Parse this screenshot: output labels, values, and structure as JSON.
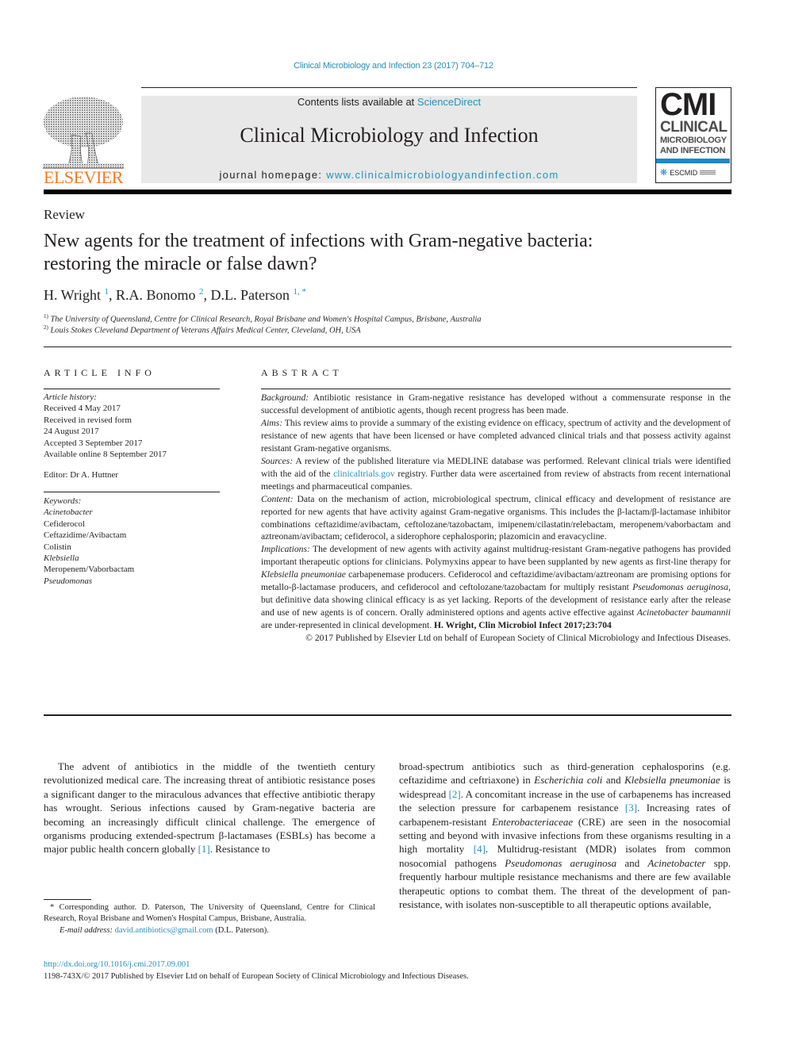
{
  "header": {
    "citation": "Clinical Microbiology and Infection 23 (2017) 704–712",
    "contents_prefix": "Contents lists available at ",
    "contents_link": "ScienceDirect",
    "journal_name": "Clinical Microbiology and Infection",
    "homepage_prefix": "journal homepage: ",
    "homepage_link": "www.clinicalmicrobiologyandinfection.com",
    "publisher_logo_text": "ELSEVIER",
    "cmi_logo": {
      "big": "CMI",
      "line1": "CLINICAL",
      "line2": "MICROBIOLOGY",
      "line3": "AND INFECTION",
      "society": "ESCMID"
    }
  },
  "article": {
    "type": "Review",
    "title": "New agents for the treatment of infections with Gram-negative bacteria: restoring the miracle or false dawn?",
    "authors": [
      {
        "name": "H. Wright",
        "sup": "1"
      },
      {
        "name": "R.A. Bonomo",
        "sup": "2"
      },
      {
        "name": "D.L. Paterson",
        "sup": "1, *"
      }
    ],
    "affiliations": [
      {
        "mark": "1)",
        "text": "The University of Queensland, Centre for Clinical Research, Royal Brisbane and Women's Hospital Campus, Brisbane, Australia"
      },
      {
        "mark": "2)",
        "text": "Louis Stokes Cleveland Department of Veterans Affairs Medical Center, Cleveland, OH, USA"
      }
    ]
  },
  "article_info": {
    "heading": "ARTICLE INFO",
    "history_label": "Article history:",
    "history": [
      "Received 4 May 2017",
      "Received in revised form",
      "24 August 2017",
      "Accepted 3 September 2017",
      "Available online 8 September 2017"
    ],
    "editor": "Editor: Dr A. Huttner",
    "keywords_label": "Keywords:",
    "keywords": [
      {
        "text": "Acinetobacter",
        "italic": true
      },
      {
        "text": "Cefiderocol",
        "italic": false
      },
      {
        "text": "Ceftazidime/Avibactam",
        "italic": false
      },
      {
        "text": "Colistin",
        "italic": false
      },
      {
        "text": "Klebsiella",
        "italic": true
      },
      {
        "text": "Meropenem/Vaborbactam",
        "italic": false
      },
      {
        "text": "Pseudomonas",
        "italic": true
      }
    ]
  },
  "abstract": {
    "heading": "ABSTRACT",
    "background_label": "Background:",
    "background": "Antibiotic resistance in Gram-negative resistance has developed without a commensurate response in the successful development of antibiotic agents, though recent progress has been made.",
    "aims_label": "Aims:",
    "aims": "This review aims to provide a summary of the existing evidence on efficacy, spectrum of activity and the development of resistance of new agents that have been licensed or have completed advanced clinical trials and that possess activity against resistant Gram-negative organisms.",
    "sources_label": "Sources:",
    "sources_a": "A review of the published literature via MEDLINE database was performed. Relevant clinical trials were identified with the aid of the ",
    "sources_link": "clinicaltrials.gov",
    "sources_b": " registry. Further data were ascertained from review of abstracts from recent international meetings and pharmaceutical companies.",
    "content_label": "Content:",
    "content": "Data on the mechanism of action, microbiological spectrum, clinical efficacy and development of resistance are reported for new agents that have activity against Gram-negative organisms. This includes the β-lactam/β-lactamase inhibitor combinations ceftazidime/avibactam, ceftolozane/tazobactam, imipenem/cilastatin/relebactam, meropenem/vaborbactam and aztreonam/avibactam; cefiderocol, a siderophore cephalosporin; plazomicin and eravacycline.",
    "implications_label": "Implications:",
    "implications_a": "The development of new agents with activity against multidrug-resistant Gram-negative pathogens has provided important therapeutic options for clinicians. Polymyxins appear to have been supplanted by new agents as first-line therapy for ",
    "implications_i1": "Klebsiella pneumoniae",
    "implications_b": " carbapenemase producers. Cefiderocol and ceftazidime/avibactam/aztreonam are promising options for metallo-β-lactamase producers, and cefiderocol and ceftolozane/tazobactam for multiply resistant ",
    "implications_i2": "Pseudomonas aeruginosa",
    "implications_c": ", but definitive data showing clinical efficacy is as yet lacking. Reports of the development of resistance early after the release and use of new agents is of concern. Orally administered options and agents active effective against ",
    "implications_i3": "Acinetobacter baumannii",
    "implications_d": " are under-represented in clinical development. ",
    "cite": "H. Wright, Clin Microbiol Infect 2017;23:704",
    "copyright": "© 2017 Published by Elsevier Ltd on behalf of European Society of Clinical Microbiology and Infectious Diseases."
  },
  "body": {
    "col1": {
      "t1": "The advent of antibiotics in the middle of the twentieth century revolutionized medical care. The increasing threat of antibiotic resistance poses a significant danger to the miraculous advances that effective antibiotic therapy has wrought. Serious infections caused by Gram-negative bacteria are becoming an increasingly difficult clinical challenge. The emergence of organisms producing extended-spectrum β-lactamases (ESBLs) has become a major public health concern globally ",
      "ref1": "[1]",
      "t2": ". Resistance to"
    },
    "col2": {
      "t1": "broad-spectrum antibiotics such as third-generation cephalosporins (e.g. ceftazidime and ceftriaxone) in ",
      "i1": "Escherichia coli",
      "t2": " and ",
      "i2": "Klebsiella pneumoniae",
      "t3": " is widespread ",
      "ref2": "[2]",
      "t4": ". A concomitant increase in the use of carbapenems has increased the selection pressure for carbapenem resistance ",
      "ref3": "[3]",
      "t5": ". Increasing rates of carbapenem-resistant ",
      "i3": "Enterobacteriaceae",
      "t6": " (CRE) are seen in the nosocomial setting and beyond with invasive infections from these organisms resulting in a high mortality ",
      "ref4": "[4]",
      "t7": ". Multidrug-resistant (MDR) isolates from common nosocomial pathogens ",
      "i4": "Pseudomonas aeruginosa",
      "t8": " and ",
      "i5": "Acinetobacter",
      "t9": " spp. frequently harbour multiple resistance mechanisms and there are few available therapeutic options to combat them. The threat of the development of pan-resistance, with isolates non-susceptible to all therapeutic options available,"
    }
  },
  "footnote": {
    "corresponding": "* Corresponding author. D. Paterson, The University of Queensland, Centre for Clinical Research, Royal Brisbane and Women's Hospital Campus, Brisbane, Australia.",
    "email_label": "E-mail address:",
    "email": "david.antibiotics@gmail.com",
    "email_suffix": " (D.L. Paterson)."
  },
  "footer": {
    "doi": "http://dx.doi.org/10.1016/j.cmi.2017.09.001",
    "issn": "1198-743X/© 2017 Published by Elsevier Ltd on behalf of European Society of Clinical Microbiology and Infectious Diseases."
  },
  "colors": {
    "link": "#2a8fb8",
    "elsevier_orange": "#f47920",
    "masthead_grey": "#e8e8e8",
    "cmi_blue": "#1e88c8"
  }
}
